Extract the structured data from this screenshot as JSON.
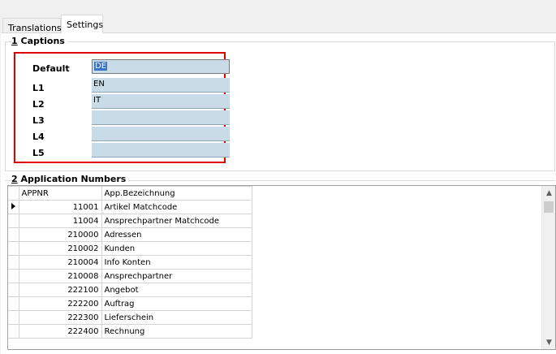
{
  "tabs": [
    {
      "label": "Translations",
      "active": false
    },
    {
      "label": "Settings",
      "active": true
    }
  ],
  "captions_group": {
    "number": "1",
    "title": "Captions",
    "rows": [
      {
        "label": "Default",
        "value": "DE"
      },
      {
        "label": "L1",
        "value": "EN"
      },
      {
        "label": "L2",
        "value": "IT"
      },
      {
        "label": "L3",
        "value": ""
      },
      {
        "label": "L4",
        "value": ""
      },
      {
        "label": "L5",
        "value": ""
      }
    ]
  },
  "applications_group": {
    "number": "2",
    "title": "Application Numbers",
    "columns": [
      "APPNR",
      "App.Bezeichnung"
    ],
    "rows": [
      {
        "appnr": "11001",
        "name": "Artikel Matchcode"
      },
      {
        "appnr": "11004",
        "name": "Ansprechpartner Matchcode"
      },
      {
        "appnr": "210000",
        "name": "Adressen"
      },
      {
        "appnr": "210002",
        "name": "Kunden"
      },
      {
        "appnr": "210004",
        "name": "Info Konten"
      },
      {
        "appnr": "210008",
        "name": "Ansprechpartner"
      },
      {
        "appnr": "222100",
        "name": "Angebot"
      },
      {
        "appnr": "222200",
        "name": "Auftrag"
      },
      {
        "appnr": "222300",
        "name": "Lieferschein"
      },
      {
        "appnr": "222400",
        "name": "Rechnung"
      }
    ]
  },
  "colors": {
    "highlight_border": "#e00000",
    "field_background": "#c9dbe6",
    "selection": "#3a73c7"
  }
}
